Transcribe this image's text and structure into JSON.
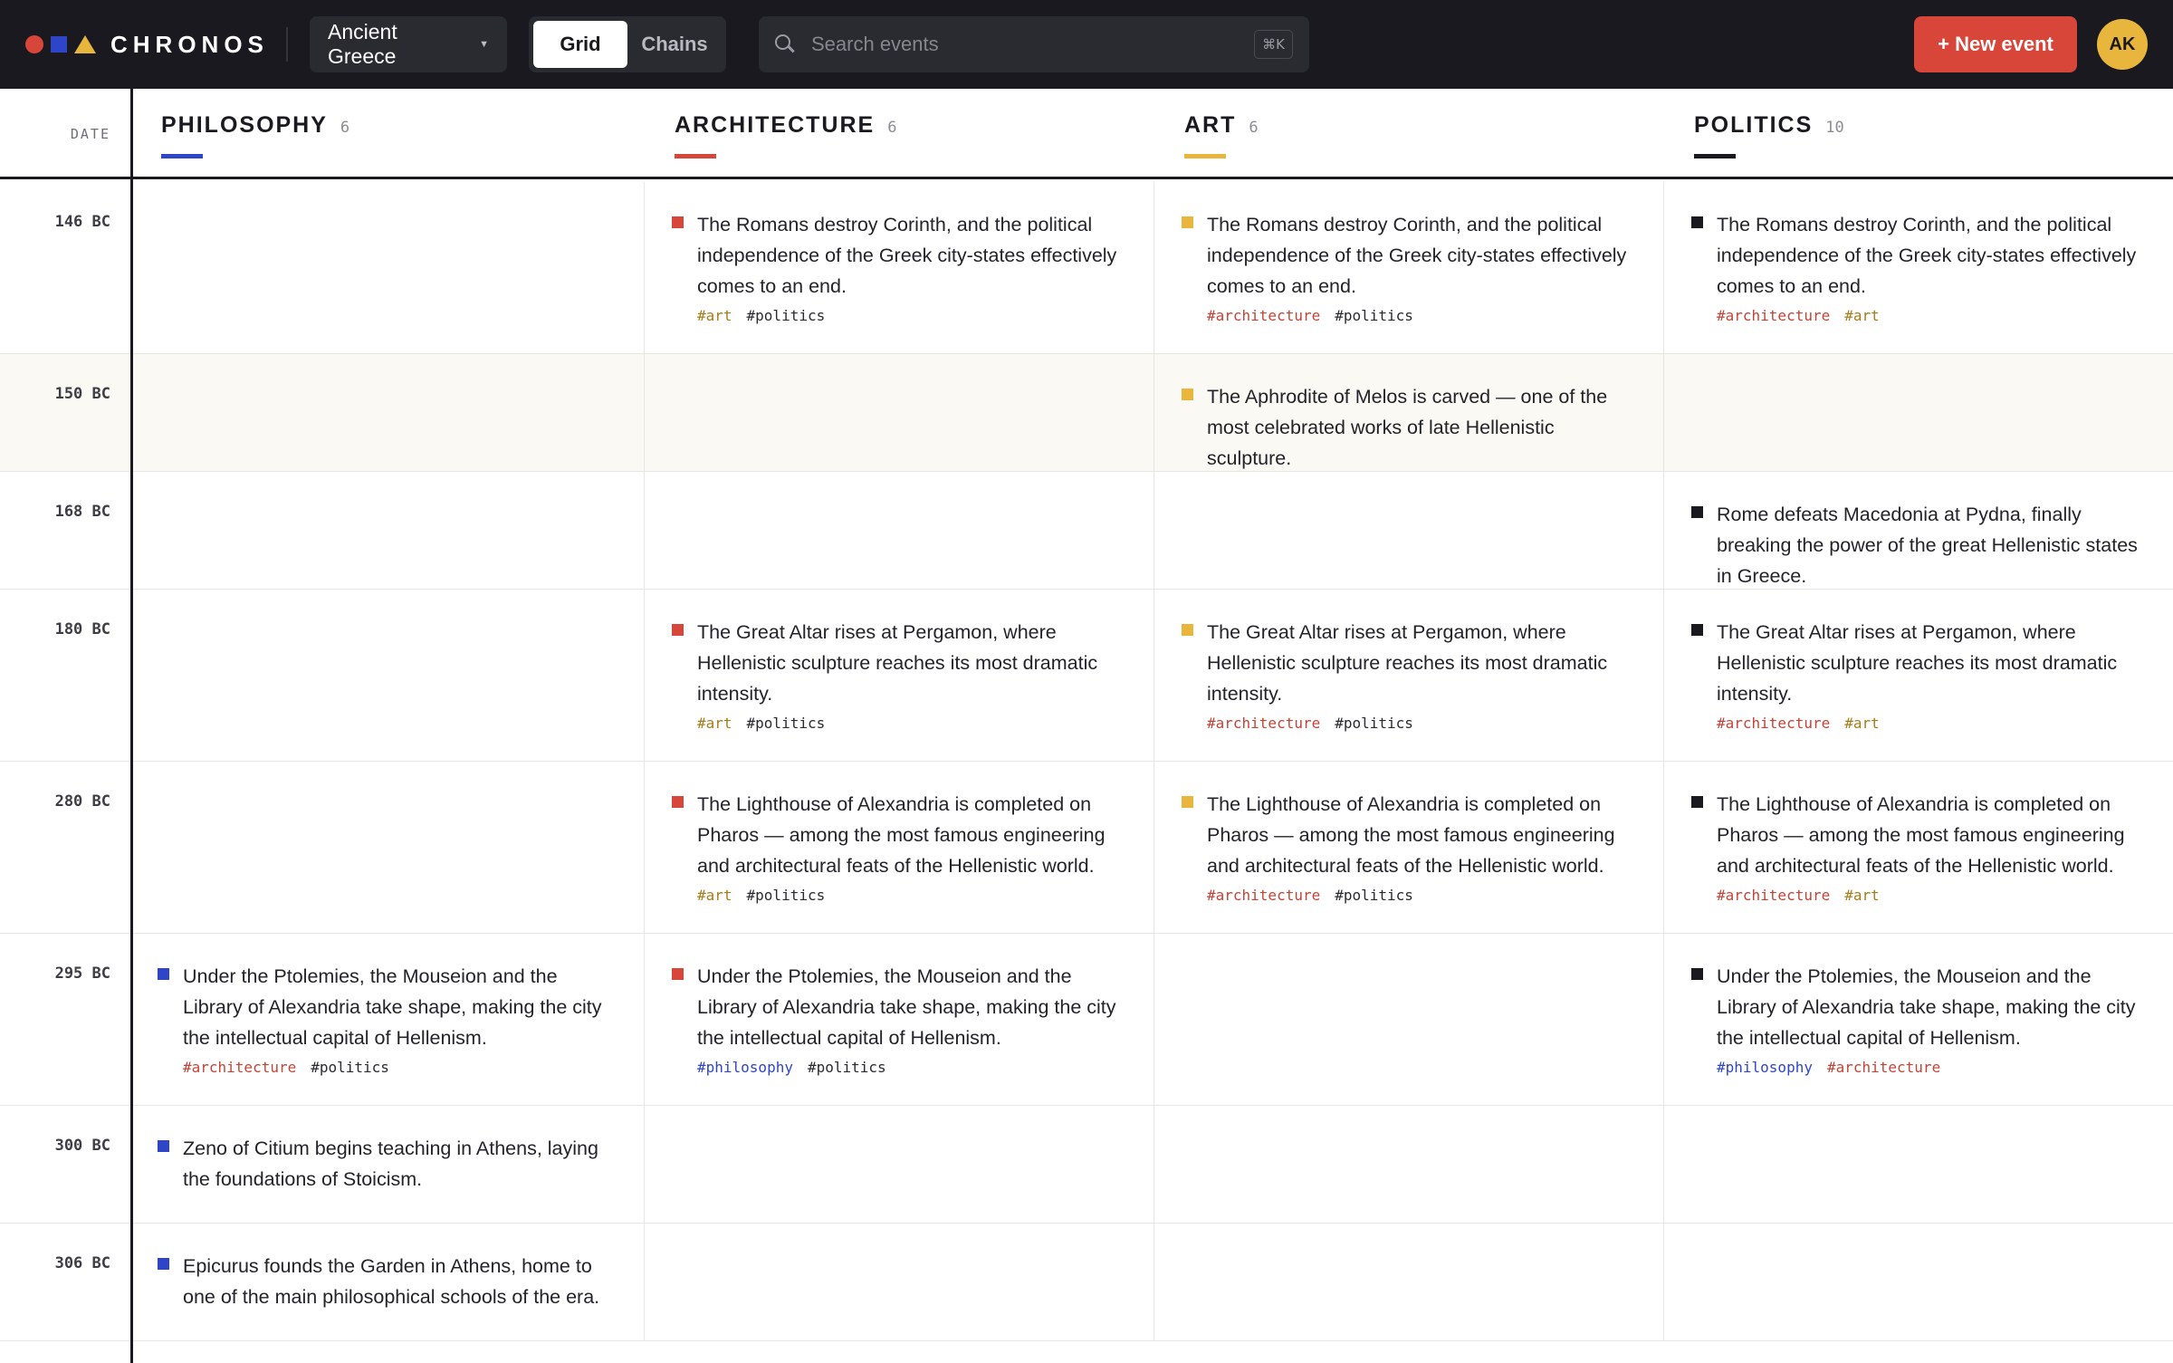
{
  "app": {
    "name": "CHRONOS"
  },
  "toolbar": {
    "project": "Ancient Greece",
    "views": [
      "Grid",
      "Chains"
    ],
    "active_view": "Grid",
    "search_placeholder": "Search events",
    "search_shortcut": "⌘K",
    "new_event_label": "+ New event",
    "user_initials": "AK"
  },
  "colors": {
    "philosophy": "#2f45c8",
    "architecture": "#d8463a",
    "art": "#e8b63c",
    "politics": "#19191f"
  },
  "grid": {
    "date_label": "DATE",
    "columns": [
      {
        "key": "philosophy",
        "title": "PHILOSOPHY",
        "count": "6"
      },
      {
        "key": "architecture",
        "title": "ARCHITECTURE",
        "count": "6"
      },
      {
        "key": "art",
        "title": "ART",
        "count": "6"
      },
      {
        "key": "politics",
        "title": "POLITICS",
        "count": "10"
      }
    ],
    "rows": [
      {
        "date": "146 BC",
        "cells": {
          "architecture": {
            "text": "The Romans destroy Corinth, and the political independence of the Greek city-states effectively comes to an end.",
            "tags": [
              "art",
              "politics"
            ]
          },
          "art": {
            "text": "The Romans destroy Corinth, and the political independence of the Greek city-states effectively comes to an end.",
            "tags": [
              "architecture",
              "politics"
            ]
          },
          "politics": {
            "text": "The Romans destroy Corinth, and the political independence of the Greek city-states effectively comes to an end.",
            "tags": [
              "architecture",
              "art"
            ]
          }
        }
      },
      {
        "date": "150 BC",
        "highlight": true,
        "cells": {
          "art": {
            "text": "The Aphrodite of Melos is carved — one of the most celebrated works of late Hellenistic sculpture.",
            "tags": []
          }
        }
      },
      {
        "date": "168 BC",
        "cells": {
          "politics": {
            "text": "Rome defeats Macedonia at Pydna, finally breaking the power of the great Hellenistic states in Greece.",
            "tags": []
          }
        }
      },
      {
        "date": "180 BC",
        "cells": {
          "architecture": {
            "text": "The Great Altar rises at Pergamon, where Hellenistic sculpture reaches its most dramatic intensity.",
            "tags": [
              "art",
              "politics"
            ]
          },
          "art": {
            "text": "The Great Altar rises at Pergamon, where Hellenistic sculpture reaches its most dramatic intensity.",
            "tags": [
              "architecture",
              "politics"
            ]
          },
          "politics": {
            "text": "The Great Altar rises at Pergamon, where Hellenistic sculpture reaches its most dramatic intensity.",
            "tags": [
              "architecture",
              "art"
            ]
          }
        }
      },
      {
        "date": "280 BC",
        "cells": {
          "architecture": {
            "text": "The Lighthouse of Alexandria is completed on Pharos — among the most famous engineering and architectural feats of the Hellenistic world.",
            "tags": [
              "art",
              "politics"
            ]
          },
          "art": {
            "text": "The Lighthouse of Alexandria is completed on Pharos — among the most famous engineering and architectural feats of the Hellenistic world.",
            "tags": [
              "architecture",
              "politics"
            ]
          },
          "politics": {
            "text": "The Lighthouse of Alexandria is completed on Pharos — among the most famous engineering and architectural feats of the Hellenistic world.",
            "tags": [
              "architecture",
              "art"
            ]
          }
        }
      },
      {
        "date": "295 BC",
        "cells": {
          "philosophy": {
            "text": "Under the Ptolemies, the Mouseion and the Library of Alexandria take shape, making the city the intellectual capital of Hellenism.",
            "tags": [
              "architecture",
              "politics"
            ]
          },
          "architecture": {
            "text": "Under the Ptolemies, the Mouseion and the Library of Alexandria take shape, making the city the intellectual capital of Hellenism.",
            "tags": [
              "philosophy",
              "politics"
            ]
          },
          "politics": {
            "text": "Under the Ptolemies, the Mouseion and the Library of Alexandria take shape, making the city the intellectual capital of Hellenism.",
            "tags": [
              "philosophy",
              "architecture"
            ]
          }
        }
      },
      {
        "date": "300 BC",
        "cells": {
          "philosophy": {
            "text": "Zeno of Citium begins teaching in Athens, laying the foundations of Stoicism.",
            "tags": []
          }
        }
      },
      {
        "date": "306 BC",
        "cells": {
          "philosophy": {
            "text": "Epicurus founds the Garden in Athens, home to one of the main philosophical schools of the era.",
            "tags": []
          }
        }
      }
    ]
  }
}
